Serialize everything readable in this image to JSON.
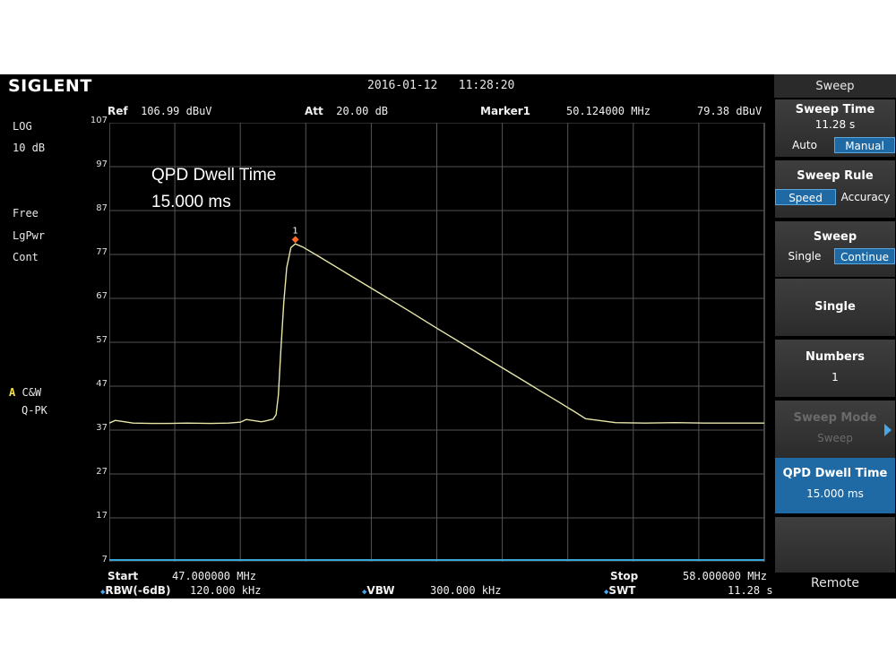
{
  "header": {
    "brand": "SIGLENT",
    "datetime": "2016-01-12   11:28:20",
    "ref_label": "Ref",
    "ref_value": "106.99 dBuV",
    "att_label": "Att",
    "att_value": "20.00 dB",
    "marker_label": "Marker1",
    "marker_freq": "50.124000 MHz",
    "marker_level": "79.38 dBuV"
  },
  "left_info": {
    "scale_type": "LOG",
    "scale_div": "10 dB",
    "trigger": "Free",
    "avg_type": "LgPwr",
    "sweep_mode": "Cont",
    "trace_id": "A",
    "trace_mode": "C&W",
    "detector": "Q-PK"
  },
  "annotation": {
    "line1": "QPD Dwell Time",
    "line2": "15.000 ms"
  },
  "footer": {
    "start_label": "Start",
    "start_value": "47.000000 MHz",
    "stop_label": "Stop",
    "stop_value": "58.000000 MHz",
    "rbw_label": "RBW(-6dB)",
    "rbw_value": "120.000 kHz",
    "vbw_label": "VBW",
    "vbw_value": "300.000 kHz",
    "swt_label": "SWT",
    "swt_value": "11.28 s"
  },
  "menu": {
    "title": "Sweep",
    "sweep_time_label": "Sweep Time",
    "sweep_time_value": "11.28 s",
    "sweep_time_opt1": "Auto",
    "sweep_time_opt2": "Manual",
    "sweep_rule_label": "Sweep Rule",
    "sweep_rule_opt1": "Speed",
    "sweep_rule_opt2": "Accuracy",
    "sweep_label": "Sweep",
    "sweep_opt1": "Single",
    "sweep_opt2": "Continue",
    "single_label": "Single",
    "numbers_label": "Numbers",
    "numbers_value": "1",
    "sweep_mode_label": "Sweep Mode",
    "sweep_mode_value": "Sweep",
    "qpd_label": "QPD Dwell Time",
    "qpd_value": "15.000 ms",
    "remote_label": "Remote"
  },
  "colors": {
    "trace": "#e8e6a8",
    "grid": "#555555",
    "accent": "#1f6aa5",
    "marker": "#ff6a2a"
  },
  "chart_data": {
    "type": "line",
    "xlim": [
      47.0,
      58.0
    ],
    "ylim": [
      7,
      107
    ],
    "yticks": [
      107,
      97,
      87,
      77,
      67,
      57,
      47,
      37,
      27,
      17,
      7
    ],
    "marker": {
      "label": "1",
      "x": 50.124,
      "y": 79.38
    },
    "series": [
      {
        "x": [
          47.0,
          47.1,
          47.2,
          47.4,
          47.7,
          48.0,
          48.3,
          48.7,
          49.0,
          49.2,
          49.3,
          49.55,
          49.6,
          49.75,
          49.8,
          49.84,
          49.88,
          49.93,
          49.98,
          50.05,
          50.124,
          50.25,
          50.5,
          51.0,
          51.5,
          52.0,
          52.5,
          53.0,
          53.5,
          54.0,
          54.3,
          54.5,
          54.8,
          55.0,
          55.5,
          56.0,
          56.5,
          57.0,
          57.5,
          58.0
        ],
        "y": [
          38.6,
          39.2,
          39.0,
          38.6,
          38.5,
          38.5,
          38.6,
          38.5,
          38.6,
          38.8,
          39.4,
          38.9,
          39.0,
          39.5,
          40.5,
          45,
          55,
          66,
          74,
          78.6,
          79.4,
          78.7,
          76.7,
          72.6,
          68.5,
          64.4,
          60.2,
          56.1,
          52.0,
          47.9,
          45.4,
          43.8,
          41.3,
          39.6,
          38.7,
          38.6,
          38.7,
          38.6,
          38.6,
          38.6
        ]
      }
    ]
  }
}
